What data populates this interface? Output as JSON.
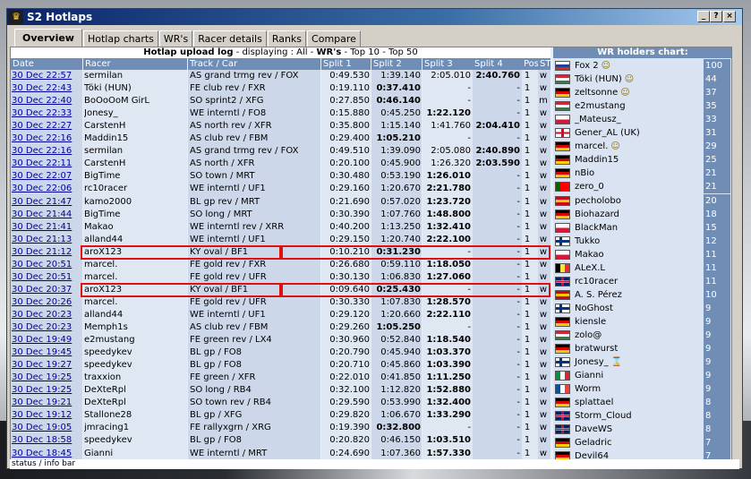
{
  "window": {
    "title": "S2 Hotlaps",
    "icon": "trophy-icon",
    "buttons": [
      "?",
      "_",
      "×"
    ]
  },
  "tabs": [
    {
      "label": "Overview",
      "active": true
    },
    {
      "label": "Hotlap charts"
    },
    {
      "label": "WR's"
    },
    {
      "label": "Racer details"
    },
    {
      "label": "Ranks"
    },
    {
      "label": "Compare"
    }
  ],
  "upload": {
    "title": "Hotlap upload log",
    "displaying": " - displaying : ",
    "all": "All",
    "sep1": " - ",
    "wrs": "WR's",
    "sep2": " - ",
    "top10": "Top 10",
    "sep3": " - ",
    "top50": "Top 50"
  },
  "columns": [
    "Date",
    "Racer",
    "Track / Car",
    "Split 1",
    "Split 2",
    "Split 3",
    "Split 4",
    "Pos",
    "ST"
  ],
  "rows": [
    {
      "date": "30 Dec 22:57",
      "racer": "sermilan",
      "track": "AS grand trmg rev / FOX",
      "s1": "0:49.530",
      "s2": "1:39.140",
      "s3": "2:05.010",
      "s4": "2:40.760",
      "pos": "1",
      "st": "w"
    },
    {
      "date": "30 Dec 22:43",
      "racer": "Töki (HUN)",
      "track": "FE club rev / FXR",
      "s1": "0:19.110",
      "s2": "0:37.410",
      "s3": "-",
      "s4": "-",
      "pos": "1",
      "st": "w"
    },
    {
      "date": "30 Dec 22:40",
      "racer": "BoOoOoM GirL",
      "track": "SO sprint2 / XFG",
      "s1": "0:27.850",
      "s2": "0:46.140",
      "s3": "-",
      "s4": "-",
      "pos": "1",
      "st": "m"
    },
    {
      "date": "30 Dec 22:33",
      "racer": "Jonesy_",
      "track": "WE interntl / FO8",
      "s1": "0:15.880",
      "s2": "0:45.250",
      "s3": "1:22.120",
      "s4": "-",
      "pos": "1",
      "st": "w"
    },
    {
      "date": "30 Dec 22:27",
      "racer": "CarstenH",
      "track": "AS north rev / XFR",
      "s1": "0:35.800",
      "s2": "1:15.140",
      "s3": "1:41.760",
      "s4": "2:04.410",
      "pos": "1",
      "st": "w"
    },
    {
      "date": "30 Dec 22:16",
      "racer": "Maddin15",
      "track": "AS club rev / FBM",
      "s1": "0:29.400",
      "s2": "1:05.210",
      "s3": "-",
      "s4": "-",
      "pos": "1",
      "st": "w"
    },
    {
      "date": "30 Dec 22:16",
      "racer": "sermilan",
      "track": "AS grand trmg rev / FOX",
      "s1": "0:49.510",
      "s2": "1:39.090",
      "s3": "2:05.080",
      "s4": "2:40.890",
      "pos": "1",
      "st": "w"
    },
    {
      "date": "30 Dec 22:11",
      "racer": "CarstenH",
      "track": "AS north / XFR",
      "s1": "0:20.100",
      "s2": "0:45.900",
      "s3": "1:26.320",
      "s4": "2:03.590",
      "pos": "1",
      "st": "w"
    },
    {
      "date": "30 Dec 22:07",
      "racer": "BigTime",
      "track": "SO town / MRT",
      "s1": "0:30.480",
      "s2": "0:53.190",
      "s3": "1:26.010",
      "s4": "-",
      "pos": "1",
      "st": "w"
    },
    {
      "date": "30 Dec 22:06",
      "racer": "rc10racer",
      "track": "WE interntl / UF1",
      "s1": "0:29.160",
      "s2": "1:20.670",
      "s3": "2:21.780",
      "s4": "-",
      "pos": "1",
      "st": "w"
    },
    {
      "date": "30 Dec 21:47",
      "racer": "kamo2000",
      "track": "BL gp rev / MRT",
      "s1": "0:21.690",
      "s2": "0:57.020",
      "s3": "1:23.720",
      "s4": "-",
      "pos": "1",
      "st": "w"
    },
    {
      "date": "30 Dec 21:44",
      "racer": "BigTime",
      "track": "SO long / MRT",
      "s1": "0:30.390",
      "s2": "1:07.760",
      "s3": "1:48.800",
      "s4": "-",
      "pos": "1",
      "st": "w"
    },
    {
      "date": "30 Dec 21:41",
      "racer": "Makao",
      "track": "WE interntl rev / XRR",
      "s1": "0:40.200",
      "s2": "1:13.250",
      "s3": "1:32.410",
      "s4": "-",
      "pos": "1",
      "st": "w"
    },
    {
      "date": "30 Dec 21:13",
      "racer": "alland44",
      "track": "WE interntl / UF1",
      "s1": "0:29.150",
      "s2": "1:20.740",
      "s3": "2:22.100",
      "s4": "-",
      "pos": "1",
      "st": "w"
    },
    {
      "date": "30 Dec 21:12",
      "racer": "aroX123",
      "track": "KY oval / BF1",
      "s1": "0:10.210",
      "s2": "0:31.230",
      "s3": "-",
      "s4": "-",
      "pos": "1",
      "st": "w"
    },
    {
      "date": "30 Dec 20:51",
      "racer": "marcel.",
      "track": "FE gold rev / FXR",
      "s1": "0:26.680",
      "s2": "0:59.110",
      "s3": "1:18.050",
      "s4": "-",
      "pos": "1",
      "st": "w"
    },
    {
      "date": "30 Dec 20:51",
      "racer": "marcel.",
      "track": "FE gold rev / UFR",
      "s1": "0:30.130",
      "s2": "1:06.830",
      "s3": "1:27.060",
      "s4": "-",
      "pos": "1",
      "st": "w"
    },
    {
      "date": "30 Dec 20:37",
      "racer": "aroX123",
      "track": "KY oval / BF1",
      "s1": "0:09.640",
      "s2": "0:25.430",
      "s3": "-",
      "s4": "-",
      "pos": "1",
      "st": "w"
    },
    {
      "date": "30 Dec 20:26",
      "racer": "marcel.",
      "track": "FE gold rev / UFR",
      "s1": "0:30.330",
      "s2": "1:07.830",
      "s3": "1:28.570",
      "s4": "-",
      "pos": "1",
      "st": "w"
    },
    {
      "date": "30 Dec 20:23",
      "racer": "alland44",
      "track": "WE interntl / UF1",
      "s1": "0:29.120",
      "s2": "1:20.660",
      "s3": "2:22.110",
      "s4": "-",
      "pos": "1",
      "st": "w"
    },
    {
      "date": "30 Dec 20:23",
      "racer": "Memph1s",
      "track": "AS club rev / FBM",
      "s1": "0:29.260",
      "s2": "1:05.250",
      "s3": "-",
      "s4": "-",
      "pos": "1",
      "st": "w"
    },
    {
      "date": "30 Dec 19:49",
      "racer": "e2mustang",
      "track": "FE green rev / LX4",
      "s1": "0:30.960",
      "s2": "0:52.840",
      "s3": "1:18.540",
      "s4": "-",
      "pos": "1",
      "st": "w"
    },
    {
      "date": "30 Dec 19:45",
      "racer": "speedykev",
      "track": "BL gp / FO8",
      "s1": "0:20.790",
      "s2": "0:45.940",
      "s3": "1:03.370",
      "s4": "-",
      "pos": "1",
      "st": "w"
    },
    {
      "date": "30 Dec 19:27",
      "racer": "speedykev",
      "track": "BL gp / FO8",
      "s1": "0:20.710",
      "s2": "0:45.860",
      "s3": "1:03.390",
      "s4": "-",
      "pos": "1",
      "st": "w"
    },
    {
      "date": "30 Dec 19:25",
      "racer": "traxxion",
      "track": "FE green / XFR",
      "s1": "0:22.010",
      "s2": "0:41.850",
      "s3": "1:11.250",
      "s4": "-",
      "pos": "1",
      "st": "w"
    },
    {
      "date": "30 Dec 19:25",
      "racer": "DeXteRpl",
      "track": "SO long / RB4",
      "s1": "0:32.100",
      "s2": "1:12.820",
      "s3": "1:52.880",
      "s4": "-",
      "pos": "1",
      "st": "w"
    },
    {
      "date": "30 Dec 19:21",
      "racer": "DeXteRpl",
      "track": "SO town rev / RB4",
      "s1": "0:29.590",
      "s2": "0:53.990",
      "s3": "1:32.400",
      "s4": "-",
      "pos": "1",
      "st": "w"
    },
    {
      "date": "30 Dec 19:12",
      "racer": "Stallone28",
      "track": "BL gp / XFG",
      "s1": "0:29.820",
      "s2": "1:06.670",
      "s3": "1:33.290",
      "s4": "-",
      "pos": "1",
      "st": "w"
    },
    {
      "date": "30 Dec 19:05",
      "racer": "jmracing1",
      "track": "FE rallyxgrn / XRG",
      "s1": "0:19.390",
      "s2": "0:32.800",
      "s3": "-",
      "s4": "-",
      "pos": "1",
      "st": "w"
    },
    {
      "date": "30 Dec 18:58",
      "racer": "speedykev",
      "track": "BL gp / FO8",
      "s1": "0:20.820",
      "s2": "0:46.150",
      "s3": "1:03.510",
      "s4": "-",
      "pos": "1",
      "st": "w"
    },
    {
      "date": "30 Dec 18:45",
      "racer": "Gianni",
      "track": "WE interntl / MRT",
      "s1": "0:24.690",
      "s2": "1:07.360",
      "s3": "1:57.330",
      "s4": "-",
      "pos": "1",
      "st": "w"
    }
  ],
  "bold_split": [
    "s4",
    "s2",
    "s2",
    "s3",
    "s4",
    "s2",
    "s4",
    "s4",
    "s3",
    "s3",
    "s3",
    "s3",
    "s3",
    "s3",
    "s2",
    "s3",
    "s3",
    "s2",
    "s3",
    "s3",
    "s2",
    "s3",
    "s3",
    "s3",
    "s3",
    "s3",
    "s3",
    "s3",
    "s2",
    "s3",
    "s3"
  ],
  "wr_holders": {
    "title": "WR holders chart:",
    "items": [
      {
        "name": "Fox 2",
        "badge": "☺",
        "count": "100",
        "flag": "ru"
      },
      {
        "name": "Töki (HUN)",
        "badge": "☺",
        "count": "44",
        "flag": "hu"
      },
      {
        "name": "zeltsonne",
        "badge": "☺",
        "count": "37",
        "flag": "de"
      },
      {
        "name": "e2mustang",
        "badge": "",
        "count": "35",
        "flag": "hu"
      },
      {
        "name": "_Mateusz_",
        "badge": "",
        "count": "33",
        "flag": "pl"
      },
      {
        "name": "Gener_AL (UK)",
        "badge": "",
        "count": "31",
        "flag": "en"
      },
      {
        "name": "marcel.",
        "badge": "☺",
        "count": "29",
        "flag": "de"
      },
      {
        "name": "Maddin15",
        "badge": "",
        "count": "25",
        "flag": "de"
      },
      {
        "name": "nBio",
        "badge": "",
        "count": "21",
        "flag": "de"
      },
      {
        "name": "zero_0",
        "badge": "",
        "count": "21",
        "flag": "pt"
      },
      {
        "name": "pecholobo",
        "badge": "",
        "count": "20",
        "flag": "es"
      },
      {
        "name": "Biohazard",
        "badge": "",
        "count": "18",
        "flag": "de"
      },
      {
        "name": "BlackMan",
        "badge": "",
        "count": "15",
        "flag": "pl"
      },
      {
        "name": "Tukko",
        "badge": "",
        "count": "12",
        "flag": "fi"
      },
      {
        "name": "Makao",
        "badge": "",
        "count": "11",
        "flag": "pl"
      },
      {
        "name": "ALeX.L",
        "badge": "",
        "count": "11",
        "flag": "be"
      },
      {
        "name": "rc10racer",
        "badge": "",
        "count": "11",
        "flag": "gb"
      },
      {
        "name": "A. S. Pérez",
        "badge": "",
        "count": "10",
        "flag": "es"
      },
      {
        "name": "NoGhost",
        "badge": "",
        "count": "9",
        "flag": "fi"
      },
      {
        "name": "kiensle",
        "badge": "",
        "count": "9",
        "flag": "de"
      },
      {
        "name": "zolo@",
        "badge": "",
        "count": "9",
        "flag": "hu"
      },
      {
        "name": "bratwurst",
        "badge": "",
        "count": "9",
        "flag": "de"
      },
      {
        "name": "Jonesy_",
        "badge": "⌛",
        "count": "9",
        "flag": "fi"
      },
      {
        "name": "Gianni",
        "badge": "",
        "count": "9",
        "flag": "it"
      },
      {
        "name": "Worm",
        "badge": "",
        "count": "9",
        "flag": "fr"
      },
      {
        "name": "splattael",
        "badge": "",
        "count": "8",
        "flag": "de"
      },
      {
        "name": "Storm_Cloud",
        "badge": "",
        "count": "8",
        "flag": "gb"
      },
      {
        "name": "DaveWS",
        "badge": "",
        "count": "8",
        "flag": "gb"
      },
      {
        "name": "Geladric",
        "badge": "",
        "count": "7",
        "flag": "de"
      },
      {
        "name": "Devil64",
        "badge": "",
        "count": "7",
        "flag": "de"
      }
    ]
  },
  "highlighted_rows": [
    14,
    17
  ],
  "status": "status / info bar",
  "colors": {
    "header": "#6f8db5",
    "link": "#0000a0",
    "highlight": "#e01010",
    "panel": "#e8eef7"
  }
}
